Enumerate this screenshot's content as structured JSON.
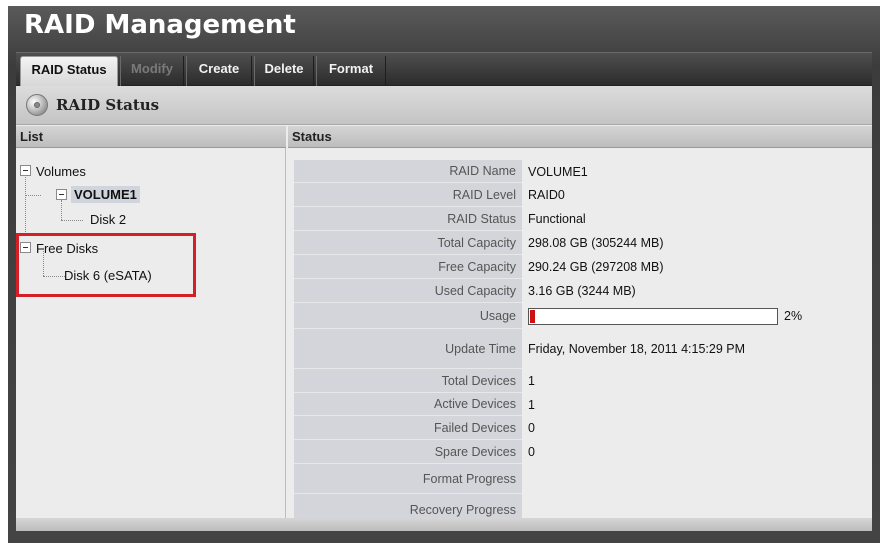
{
  "app": {
    "title": "RAID Management"
  },
  "tabs": [
    {
      "label": "RAID Status",
      "active": true,
      "disabled": false
    },
    {
      "label": "Modify",
      "active": false,
      "disabled": true
    },
    {
      "label": "Create",
      "active": false,
      "disabled": false
    },
    {
      "label": "Delete",
      "active": false,
      "disabled": false
    },
    {
      "label": "Format",
      "active": false,
      "disabled": false
    }
  ],
  "section": {
    "title": "RAID Status",
    "icon": "disc-icon"
  },
  "list": {
    "header": "List",
    "tree": {
      "volumes_label": "Volumes",
      "volume_name": "VOLUME1",
      "volume_disk": "Disk 2",
      "free_disks_label": "Free Disks",
      "free_disk": "Disk 6 (eSATA)"
    }
  },
  "status": {
    "header": "Status",
    "rows": [
      {
        "label": "RAID Name",
        "value": "VOLUME1"
      },
      {
        "label": "RAID Level",
        "value": "RAID0"
      },
      {
        "label": "RAID Status",
        "value": "Functional"
      },
      {
        "label": "Total Capacity",
        "value": "298.08 GB (305244 MB)"
      },
      {
        "label": "Free Capacity",
        "value": "290.24 GB (297208 MB)"
      },
      {
        "label": "Used Capacity",
        "value": "3.16 GB (3244 MB)"
      },
      {
        "label": "Usage",
        "value": "2%"
      },
      {
        "label": "Update Time",
        "value": "Friday, November 18, 2011 4:15:29 PM"
      },
      {
        "label": "Total Devices",
        "value": "1"
      },
      {
        "label": "Active Devices",
        "value": "1"
      },
      {
        "label": "Failed Devices",
        "value": "0"
      },
      {
        "label": "Spare Devices",
        "value": "0"
      },
      {
        "label": "Format Progress",
        "value": ""
      },
      {
        "label": "Recovery Progress",
        "value": ""
      }
    ],
    "usage_fraction": 0.02
  },
  "colors": {
    "highlight": "#d41f26",
    "usage_fill": "#d01010"
  }
}
